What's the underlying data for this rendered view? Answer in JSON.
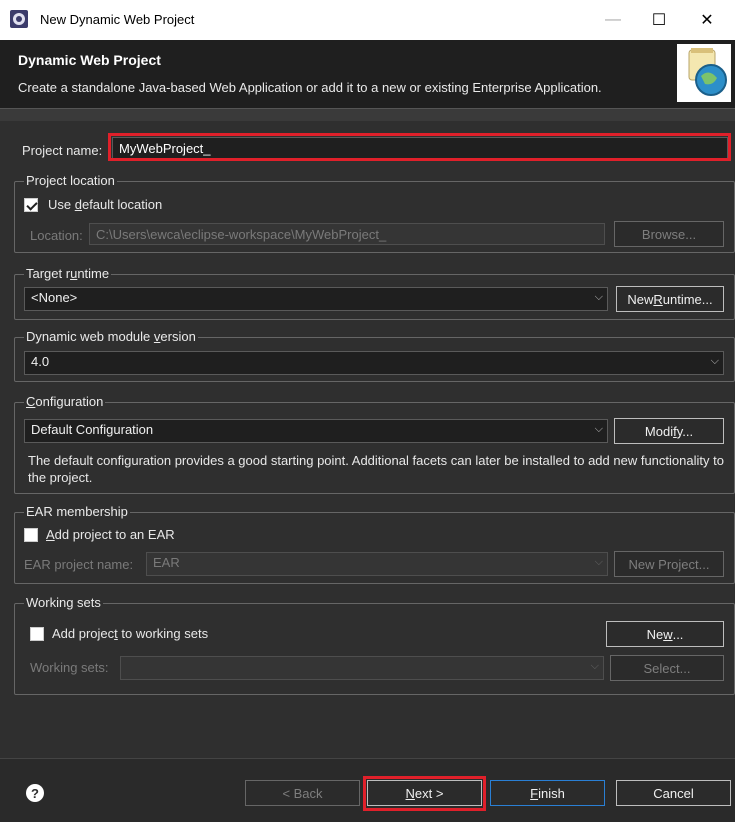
{
  "window": {
    "title": "New Dynamic Web Project",
    "minimize": "—",
    "maximize": "☐",
    "close": "✕"
  },
  "banner": {
    "heading": "Dynamic Web Project",
    "description": "Create a standalone Java-based Web Application or add it to a new or existing Enterprise Application."
  },
  "project_name": {
    "label": "Project name:",
    "value": "MyWebProject_"
  },
  "project_location": {
    "group_label": "Project location",
    "use_default_pre": "Use ",
    "use_default_u": "d",
    "use_default_post": "efault location",
    "use_default_checked": true,
    "location_label": "Location:",
    "location_value": "C:\\Users\\ewca\\eclipse-workspace\\MyWebProject_",
    "browse": "Browse..."
  },
  "target_runtime": {
    "group_pre": "Target r",
    "group_u": "u",
    "group_post": "ntime",
    "selected": "<None>",
    "new_runtime_pre": "New ",
    "new_runtime_u": "R",
    "new_runtime_post": "untime..."
  },
  "module_version": {
    "group_pre": "Dynamic web module ",
    "group_u": "v",
    "group_post": "ersion",
    "selected": "4.0"
  },
  "configuration": {
    "group_u": "C",
    "group_post": "onfiguration",
    "selected": "Default Configuration",
    "modify_pre": "Modi",
    "modify_u": "f",
    "modify_post": "y...",
    "description": "The default configuration provides a good starting point. Additional facets can later be installed to add new functionality to the project."
  },
  "ear": {
    "group_label": "EAR membership",
    "add_u": "A",
    "add_post": "dd project to an EAR",
    "add_checked": false,
    "project_label": "EAR project name:",
    "project_value": "EAR",
    "new_project": "New Project..."
  },
  "working_sets": {
    "group_label": "Working sets",
    "add_pre": "Add projec",
    "add_u": "t",
    "add_post": " to working sets",
    "add_checked": false,
    "new_pre": "Ne",
    "new_u": "w",
    "new_post": "...",
    "sets_label": "Working sets:",
    "select": "Select..."
  },
  "footer": {
    "help": "?",
    "back": "< Back",
    "next_u": "N",
    "next_post": "ext >",
    "finish_u": "F",
    "finish_post": "inish",
    "cancel": "Cancel"
  },
  "colors": {
    "highlight": "#e0202a",
    "dialog_bg": "#2f2f2f",
    "banner_bg": "#1f1f1f"
  }
}
